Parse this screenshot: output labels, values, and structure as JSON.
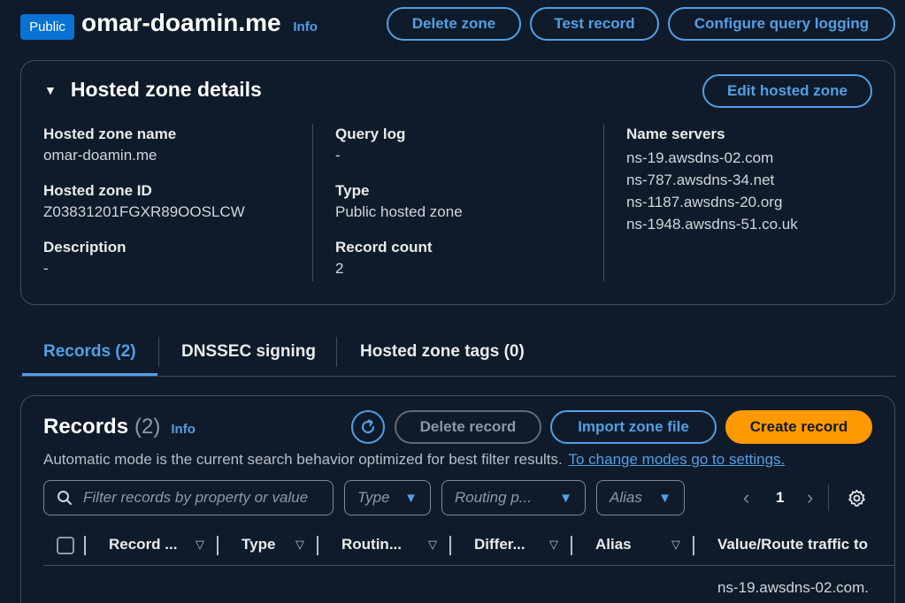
{
  "header": {
    "badge": "Public",
    "title": "omar-doamin.me",
    "info": "Info",
    "buttons": {
      "delete_zone": "Delete zone",
      "test_record": "Test record",
      "configure_logging": "Configure query logging"
    }
  },
  "details": {
    "heading": "Hosted zone details",
    "edit_button": "Edit hosted zone",
    "hosted_zone_name_label": "Hosted zone name",
    "hosted_zone_name": "omar-doamin.me",
    "hosted_zone_id_label": "Hosted zone ID",
    "hosted_zone_id": "Z03831201FGXR89OOSLCW",
    "description_label": "Description",
    "description": "-",
    "query_log_label": "Query log",
    "query_log": "-",
    "type_label": "Type",
    "type": "Public hosted zone",
    "record_count_label": "Record count",
    "record_count": "2",
    "name_servers_label": "Name servers",
    "name_servers": [
      "ns-19.awsdns-02.com",
      "ns-787.awsdns-34.net",
      "ns-1187.awsdns-20.org",
      "ns-1948.awsdns-51.co.uk"
    ]
  },
  "tabs": [
    {
      "label": "Records (2)",
      "active": true
    },
    {
      "label": "DNSSEC signing",
      "active": false
    },
    {
      "label": "Hosted zone tags (0)",
      "active": false
    }
  ],
  "records": {
    "heading": "Records",
    "count": "(2)",
    "info": "Info",
    "delete_button": "Delete record",
    "import_button": "Import zone file",
    "create_button": "Create record",
    "mode_text": "Automatic mode is the current search behavior optimized for best filter results.",
    "mode_link": "To change modes go to settings.",
    "search_placeholder": "Filter records by property or value",
    "filter_type": "Type",
    "filter_routing": "Routing p...",
    "filter_alias": "Alias",
    "page": "1",
    "columns": [
      "Record ...",
      "Type",
      "Routin...",
      "Differ...",
      "Alias",
      "Value/Route traffic to"
    ],
    "first_row_value": "ns-19.awsdns-02.com."
  },
  "colors": {
    "background": "#0f1b2a",
    "accent": "#539fe5",
    "primary": "#ff9900",
    "badge": "#0972d3"
  }
}
